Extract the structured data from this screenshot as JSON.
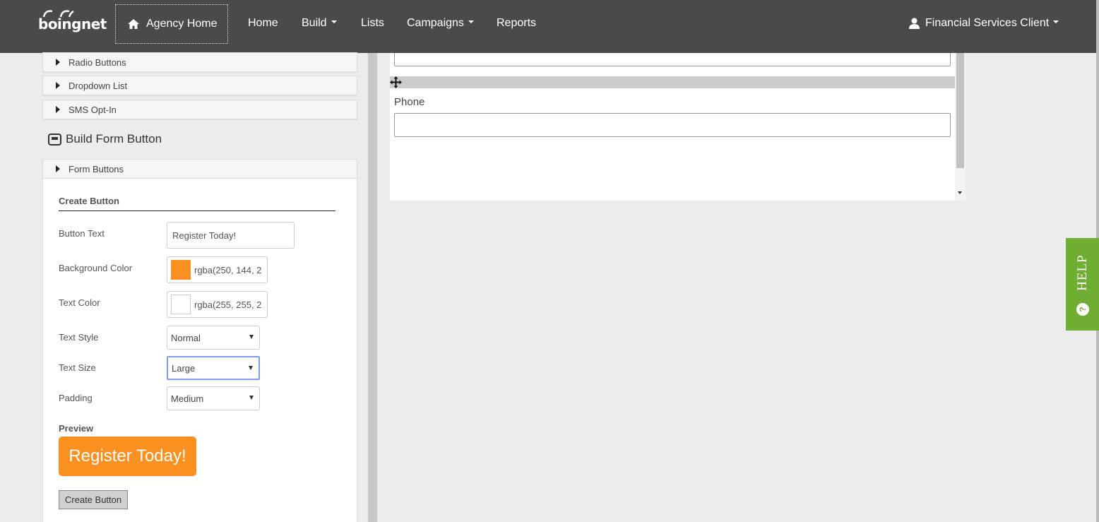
{
  "topnav": {
    "logo_text": "boingnet",
    "agency_home": "Agency Home",
    "links": {
      "home": "Home",
      "build": "Build",
      "lists": "Lists",
      "campaigns": "Campaigns",
      "reports": "Reports"
    },
    "user": "Financial Services Client"
  },
  "sidebar": {
    "accordion_items": [
      "Radio Buttons",
      "Dropdown List",
      "SMS Opt-In"
    ],
    "section_title": "Build Form Button",
    "form_buttons_label": "Form Buttons"
  },
  "create_button": {
    "heading": "Create Button",
    "button_text_label": "Button Text",
    "button_text_value": "Register Today!",
    "bg_color_label": "Background Color",
    "bg_color_value": "rgba(250, 144, 2",
    "bg_color_hex": "#fa9020",
    "text_color_label": "Text Color",
    "text_color_value": "rgba(255, 255, 2",
    "text_color_hex": "#ffffff",
    "text_style_label": "Text Style",
    "text_style_value": "Normal",
    "text_size_label": "Text Size",
    "text_size_value": "Large",
    "padding_label": "Padding",
    "padding_value": "Medium",
    "preview_label": "Preview",
    "preview_button_text": "Register Today!",
    "submit_label": "Create Button"
  },
  "canvas": {
    "phone_label": "Phone"
  },
  "help": {
    "label": "HELP",
    "icon_glyph": "?"
  }
}
